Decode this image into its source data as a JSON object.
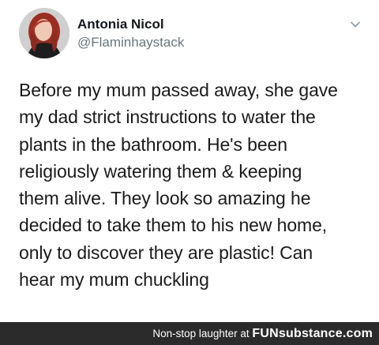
{
  "tweet": {
    "author_name": "Antonia Nicol",
    "author_handle": "@Flaminhaystack",
    "menu_icon": "chevron-down-icon",
    "avatar_icon": "avatar",
    "text": "Before my mum passed away, she gave\nmy dad strict instructions to water the\nplants in the bathroom. He's been\nreligiously watering them & keeping\nthem alive. They look so amazing he\ndecided to take them to his new home,\nonly to discover they are plastic! Can\nhear my mum chuckling"
  },
  "footer": {
    "caption": "Non-stop laughter at",
    "brand_fun": "FUN",
    "brand_rest": "substance.com"
  },
  "colors": {
    "name": "#14171a",
    "handle": "#66757f",
    "footer_bg": "#2b2b2b",
    "footer_text": "#ffffff"
  }
}
